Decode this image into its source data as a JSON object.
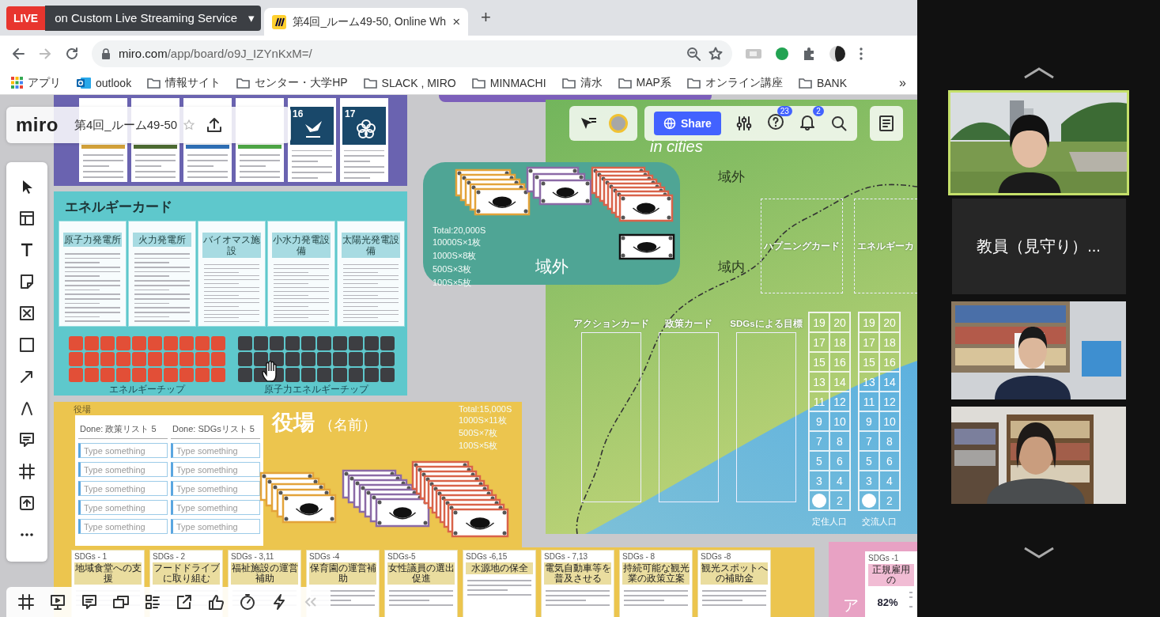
{
  "browser": {
    "tabs": [
      {
        "live_badge": "LIVE",
        "title": "on Custom Live Streaming Service",
        "menu": "▾",
        "selected": false
      },
      {
        "title": "第4回_ルーム49-50, Online Wh",
        "close": "×",
        "selected": true
      }
    ],
    "new_tab": "+",
    "address": {
      "host": "miro.com",
      "path": "/app/board/o9J_IZYnKxM=/"
    },
    "bookmarks": [
      {
        "kind": "apps",
        "label": "アプリ"
      },
      {
        "kind": "outlook",
        "label": "outlook"
      },
      {
        "kind": "folder",
        "label": "情報サイト"
      },
      {
        "kind": "folder",
        "label": "センター・大学HP"
      },
      {
        "kind": "folder",
        "label": "SLACK , MIRO"
      },
      {
        "kind": "folder",
        "label": "MINMACHI"
      },
      {
        "kind": "folder",
        "label": "清水"
      },
      {
        "kind": "folder",
        "label": "MAP系"
      },
      {
        "kind": "folder",
        "label": "オンライン講座"
      },
      {
        "kind": "folder",
        "label": "BANK"
      }
    ],
    "more_bookmarks": "»"
  },
  "miro": {
    "logo": "miro",
    "board_title": "第4回_ルーム49-50",
    "starred": false,
    "share": "Share",
    "help_count": "23",
    "notification_count": "2",
    "zoom": "82%"
  },
  "board": {
    "sdg_cards": [
      {
        "kind": "bar",
        "color": "#d3a23a"
      },
      {
        "kind": "bar",
        "color": "#4d6b32"
      },
      {
        "kind": "bar",
        "color": "#2f6fb5"
      },
      {
        "kind": "bar",
        "color": "#4ea646"
      },
      {
        "kind": "goal",
        "number": "16"
      },
      {
        "kind": "goal",
        "number": "17"
      }
    ],
    "energy": {
      "title": "エネルギーカード",
      "cards": [
        {
          "title": "原子力発電所"
        },
        {
          "title": "火力発電所"
        },
        {
          "title": "バイオマス施設"
        },
        {
          "title": "小水力発電設備"
        },
        {
          "title": "太陽光発電設備"
        }
      ],
      "chips": [
        {
          "label": "エネルギーチップ",
          "color": "#e24f37"
        },
        {
          "label": "原子力エネルギーチップ",
          "color": "#3d3e42"
        }
      ]
    },
    "outside": {
      "label": "域外",
      "totals": [
        "Total:20,000S",
        "10000S×1枚",
        "1000S×8枚",
        "500S×3枚",
        "100S×5枚"
      ]
    },
    "map": {
      "subtitle": "in cities",
      "regions": [
        "域外",
        "域内"
      ],
      "slots": [
        "ハプニングカード",
        "エネルギーカ"
      ],
      "columns": [
        "アクションカード",
        "政策カード",
        "SDGsによる目標"
      ],
      "counters": [
        {
          "label": "定住人口",
          "numbers": [
            "19",
            "20",
            "17",
            "18",
            "15",
            "16",
            "13",
            "14",
            "11",
            "12",
            "9",
            "10",
            "7",
            "8",
            "5",
            "6",
            "3",
            "4",
            "2"
          ],
          "token": true
        },
        {
          "label": "交流人口",
          "numbers": [
            "19",
            "20",
            "17",
            "18",
            "15",
            "16",
            "13",
            "14",
            "11",
            "12",
            "9",
            "10",
            "7",
            "8",
            "5",
            "6",
            "3",
            "4",
            "2"
          ],
          "token": true
        }
      ]
    },
    "town_hall": {
      "corner_label": "役場",
      "title": "役場",
      "name_hint": "（名前）",
      "totals": [
        "Total:15,000S",
        "1000S×11枚",
        "500S×7枚",
        "100S×5枚"
      ],
      "lists": [
        {
          "header": "Done: 政策リスト  5",
          "items": [
            {
              "placeholder": "Type something"
            },
            {
              "placeholder": "Type something"
            },
            {
              "placeholder": "Type something"
            },
            {
              "placeholder": "Type something"
            },
            {
              "placeholder": "Type something"
            }
          ]
        },
        {
          "header": "Done: SDGsリスト  5",
          "items": [
            {
              "placeholder": "Type something"
            },
            {
              "placeholder": "Type something"
            },
            {
              "placeholder": "Type something"
            },
            {
              "placeholder": "Type something"
            },
            {
              "placeholder": "Type something"
            }
          ]
        }
      ]
    },
    "policy_cards": [
      {
        "tag": "SDGs - 1",
        "title": "地域食堂への支援"
      },
      {
        "tag": "SDGs - 2",
        "title": "フードドライブに取り組む"
      },
      {
        "tag": "SDGs - 3,11",
        "title": "福祉施設の運営補助"
      },
      {
        "tag": "SDGs -4",
        "title": "保育園の運営補助"
      },
      {
        "tag": "SDGs-5",
        "title": "女性議員の選出促進"
      },
      {
        "tag": "SDGs -6,15",
        "title": "水源地の保全"
      },
      {
        "tag": "SDGs - 7,13",
        "title": "電気自動車等を普及させる"
      },
      {
        "tag": "SDGs - 8",
        "title": "持続可能な観光業の政策立案"
      },
      {
        "tag": "SDGs -8",
        "title": "観光スポットへの補助金"
      }
    ],
    "side_panel": {
      "label": "ア",
      "cards": [
        {
          "tag": "SDGs -1",
          "title": "正規雇用の"
        }
      ]
    }
  },
  "video_panel": {
    "tiles": [
      {
        "kind": "video",
        "speaking": true
      },
      {
        "kind": "name",
        "name": "教員（見守り）..."
      },
      {
        "kind": "video",
        "speaking": false
      },
      {
        "kind": "video",
        "speaking": false
      }
    ]
  }
}
